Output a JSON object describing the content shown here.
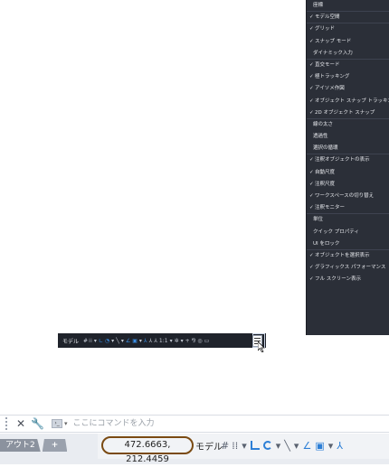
{
  "customization_menu": {
    "items": [
      {
        "label": "座標",
        "checked": false
      },
      {
        "label": "モデル空間",
        "checked": true
      },
      {
        "label": "グリッド",
        "checked": true
      },
      {
        "label": "スナップ モード",
        "checked": true
      },
      {
        "label": "ダイナミック入力",
        "checked": false
      },
      {
        "label": "直交モード",
        "checked": true
      },
      {
        "label": "極トラッキング",
        "checked": true
      },
      {
        "label": "アイソメ作図",
        "checked": true
      },
      {
        "label": "オブジェクト スナップ トラッキング",
        "checked": true
      },
      {
        "label": "2D オブジェクト スナップ",
        "checked": true
      },
      {
        "label": "線の太さ",
        "checked": false
      },
      {
        "label": "透過性",
        "checked": false
      },
      {
        "label": "選択の循環",
        "checked": false
      },
      {
        "label": "注釈オブジェクトの表示",
        "checked": true
      },
      {
        "label": "自動尺度",
        "checked": true
      },
      {
        "label": "注釈尺度",
        "checked": true
      },
      {
        "label": "ワークスペースの切り替え",
        "checked": true
      },
      {
        "label": "注釈モニター",
        "checked": true
      },
      {
        "label": "単位",
        "checked": false
      },
      {
        "label": "クイック プロパティ",
        "checked": false
      },
      {
        "label": "UI をロック",
        "checked": false
      },
      {
        "label": "オブジェクトを選択表示",
        "checked": true
      },
      {
        "label": "グラフィックス パフォーマンス",
        "checked": true
      },
      {
        "label": "フル スクリーン表示",
        "checked": true
      }
    ],
    "check_mark": "✓"
  },
  "mini_status_bar": {
    "model_label": "モデル",
    "scale_label": "1:1",
    "icons": {
      "grid": "grid-icon",
      "snap": "snap-icon",
      "ortho": "ortho-icon",
      "polar": "polar-tracking-icon",
      "osnap": "object-snap-icon",
      "annotation": "annotation-visibility-icon",
      "workspace": "workspace-gear-icon",
      "customize": "customize-menu-icon"
    }
  },
  "command_line": {
    "placeholder": "ここにコマンドを入力",
    "prompt_icon": "›_"
  },
  "bottom_bar": {
    "layout_tabs": [
      "アウト2"
    ],
    "add_tab_label": "+",
    "coordinates": "472.6663, 212.4459",
    "model_label": "モデル"
  },
  "colors": {
    "menu_background": "#2b2f38",
    "menu_text": "#e8eaee",
    "accent_blue": "#2d7fd6",
    "highlight_ellipse": "#7a4a12"
  }
}
